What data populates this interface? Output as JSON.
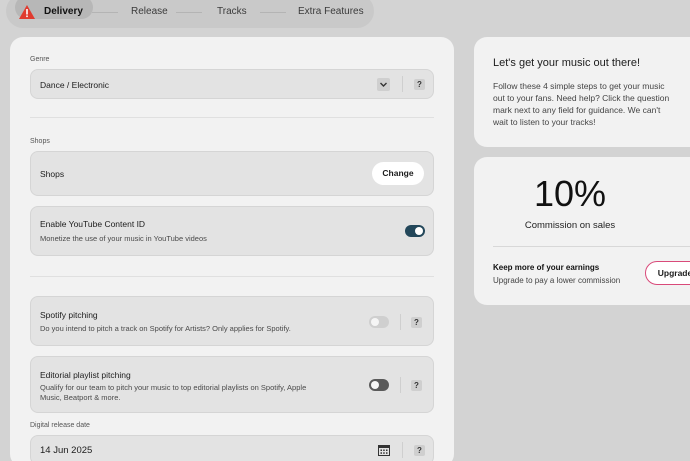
{
  "stepper": {
    "steps": [
      {
        "label": "Delivery",
        "active": true,
        "icon": "warning-icon"
      },
      {
        "label": "Release",
        "active": false
      },
      {
        "label": "Tracks",
        "active": false
      },
      {
        "label": "Extra Features",
        "active": false
      }
    ]
  },
  "form": {
    "genre": {
      "label": "Genre",
      "value": "Dance / Electronic",
      "help": "?"
    },
    "shops_section_label": "Shops",
    "shops": {
      "title": "Shops",
      "button": "Change"
    },
    "youtube": {
      "title": "Enable YouTube Content ID",
      "subtitle": "Monetize the use of your music in YouTube videos",
      "enabled": true
    },
    "spotify": {
      "title": "Spotify pitching",
      "subtitle": "Do you intend to pitch a track on Spotify for Artists? Only applies for Spotify.",
      "enabled": false,
      "help": "?"
    },
    "editorial": {
      "title": "Editorial playlist pitching",
      "subtitle_line1": "Qualify for our team to pitch your music to top editorial playlists on Spotify, Apple",
      "subtitle_line2": "Music, Beatport & more.",
      "enabled": false,
      "help": "?"
    },
    "release_date": {
      "label": "Digital release date",
      "value": "14 Jun 2025",
      "help": "?"
    }
  },
  "info_card": {
    "title": "Let's get your music out there!",
    "lines": [
      "Follow these 4 simple steps to get your music",
      "out to your fans. Need help? Click the question",
      "mark next to any field for guidance. We can't",
      "wait to listen to your tracks!"
    ]
  },
  "commission_card": {
    "percent": "10%",
    "caption": "Commission on sales",
    "promo_title": "Keep more of your earnings",
    "promo_sub": "Upgrade to pay a lower commission",
    "button": "Upgrade"
  },
  "colors": {
    "accent": "#23475a",
    "warning": "#e03b2f",
    "upgrade_border": "#d94a7a"
  }
}
